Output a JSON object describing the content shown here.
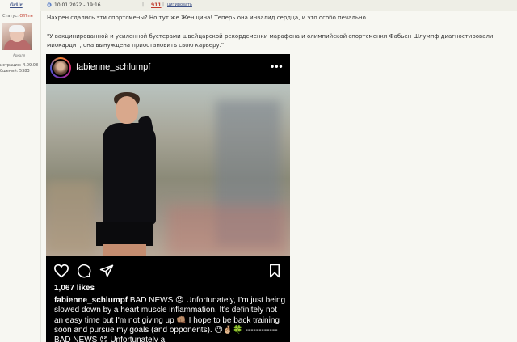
{
  "user": {
    "name": "GrUr",
    "status_label": "Статус:",
    "status_value": "Offline",
    "avatar_caption": "Аркаля",
    "registration": "истрация: 4.09.08",
    "messages": "бщений: 5383"
  },
  "post": {
    "date": "10.01.2022 - 19:16",
    "number": "911",
    "quote_label": "цитировать",
    "sep_open": "|",
    "sep_close": "|",
    "text_1": "Нахрен сдались эти спортсмены? Но тут же Женщина! Теперь она инвалид сердца, и это особо печально.",
    "text_2": "\"У вакцинированной и усиленной бустерами швейцарской рекордсменки марафона и олимпийской спортсменки Фабьен Шлумпф диагностировали миокардит, она вынуждена приостановить свою карьеру.\""
  },
  "instagram": {
    "username": "fabienne_schlumpf",
    "more": "•••",
    "likes": "1,067 likes",
    "caption_user": "fabienne_schlumpf",
    "caption_text": " BAD NEWS 😞 Unfortunately, I'm just being slowed down by a heart muscle inflammation. It's definitely not an easy time but I'm not giving up 👊🏽 I hope to be back training soon and pursue my goals (and opponents). 😉🤞🏼🍀 ------------ BAD NEWS 😞 Unfortunately a"
  },
  "colors": {
    "link": "#3b4f86",
    "offline": "#c0392b",
    "post_number": "#c0392b",
    "ig_background": "#000000"
  },
  "icons": [
    "post-icon",
    "heart-icon",
    "comment-icon",
    "share-icon",
    "bookmark-icon",
    "more-icon"
  ]
}
